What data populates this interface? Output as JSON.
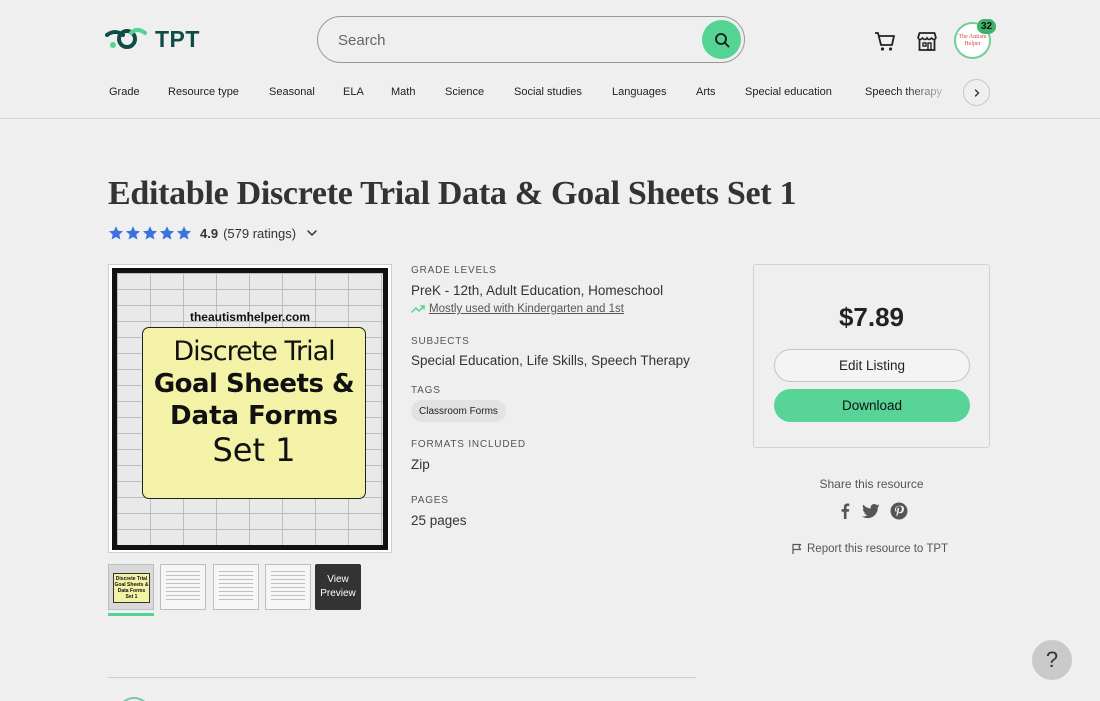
{
  "header": {
    "logo_text": "TPT",
    "search_placeholder": "Search",
    "avatar_text": "The Autism Helper",
    "notification_count": "32"
  },
  "nav": {
    "items": [
      {
        "label": "Grade"
      },
      {
        "label": "Resource type"
      },
      {
        "label": "Seasonal"
      },
      {
        "label": "ELA"
      },
      {
        "label": "Math"
      },
      {
        "label": "Science"
      },
      {
        "label": "Social studies"
      },
      {
        "label": "Languages"
      },
      {
        "label": "Arts"
      },
      {
        "label": "Special education"
      },
      {
        "label": "Speech therapy"
      }
    ]
  },
  "product": {
    "title": "Editable Discrete Trial Data & Goal Sheets Set 1",
    "rating_value": "4.9",
    "rating_count": "(579 ratings)",
    "stars": 5,
    "cover": {
      "site": "theautismhelper.com",
      "line1": "Discrete Trial",
      "line2": "Goal Sheets &",
      "line3": "Data Forms",
      "line4": "Set 1"
    },
    "thumbnail_text": "Discrete Trial Goal Sheets & Data Forms Set 1",
    "view_preview": "View Preview"
  },
  "details": {
    "grade_levels_label": "GRADE LEVELS",
    "grade_levels": "PreK - 12th, Adult Education, Homeschool",
    "mostly_used": "Mostly used with Kindergarten and 1st",
    "subjects_label": "SUBJECTS",
    "subjects": "Special Education, Life Skills, Speech Therapy",
    "tags_label": "TAGS",
    "tag": "Classroom Forms",
    "formats_label": "FORMATS INCLUDED",
    "formats": "Zip",
    "pages_label": "PAGES",
    "pages": "25 pages"
  },
  "purchase": {
    "price": "$7.89",
    "edit_label": "Edit Listing",
    "download_label": "Download",
    "share_label": "Share this resource",
    "report_label": "Report this resource to TPT"
  },
  "help_label": "?",
  "colors": {
    "accent_green": "#54d393",
    "brand_dark": "#0f4c46",
    "star_blue": "#3b72e0",
    "background": "#efefef"
  }
}
